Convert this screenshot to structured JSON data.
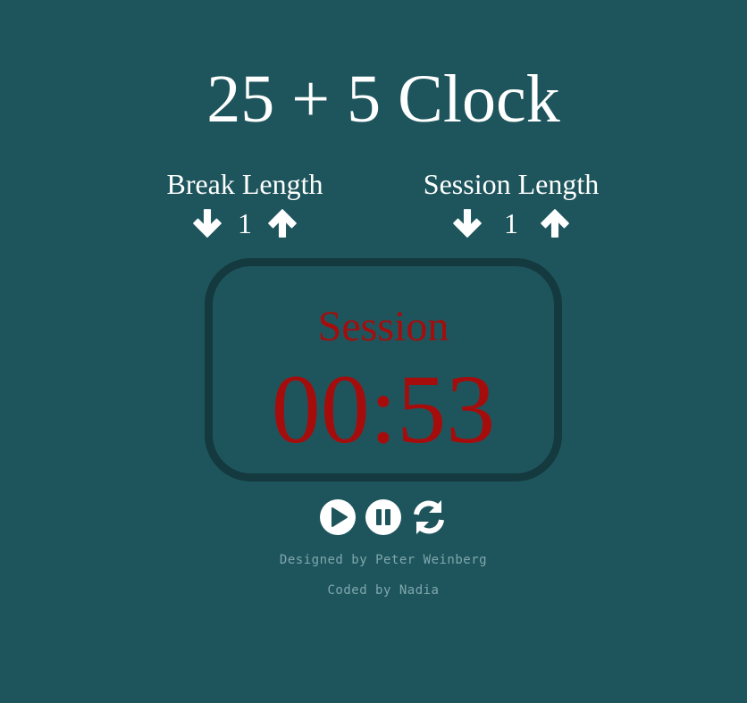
{
  "app": {
    "title": "25 + 5 Clock"
  },
  "break": {
    "label": "Break Length",
    "value": "1",
    "decrement_icon": "arrow-down-icon",
    "increment_icon": "arrow-up-icon"
  },
  "session": {
    "label": "Session Length",
    "value": "1",
    "decrement_icon": "arrow-down-icon",
    "increment_icon": "arrow-up-icon"
  },
  "timer": {
    "label": "Session",
    "time": "00:53",
    "color": "#a50d0d"
  },
  "playback": {
    "play_icon": "play-icon",
    "pause_icon": "pause-icon",
    "reset_icon": "refresh-icon"
  },
  "credits": {
    "designed": "Designed by Peter Weinberg",
    "coded": "Coded by Nadia"
  },
  "colors": {
    "background": "#1e555c",
    "timer_border": "#14393e",
    "credit_text": "#7fa7ad"
  }
}
